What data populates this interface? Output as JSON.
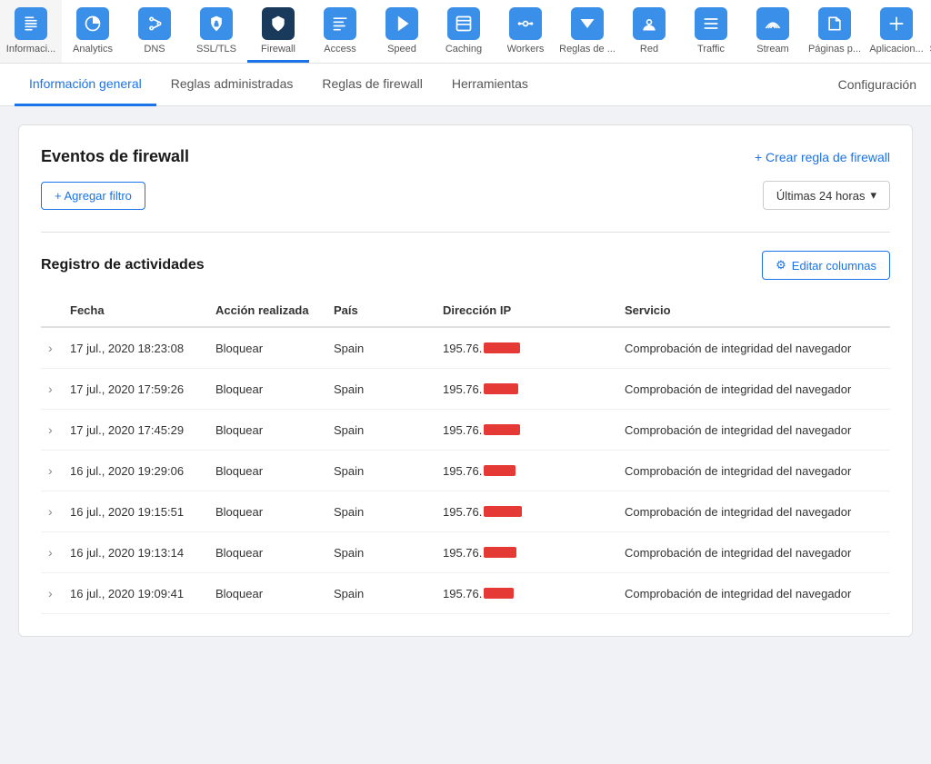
{
  "nav": {
    "items": [
      {
        "id": "informacion",
        "label": "Informaci...",
        "icon": "📄",
        "iconBg": "#3a8fe8",
        "active": false
      },
      {
        "id": "analytics",
        "label": "Analytics",
        "icon": "📊",
        "iconBg": "#3a8fe8",
        "active": false
      },
      {
        "id": "dns",
        "label": "DNS",
        "icon": "🔀",
        "iconBg": "#3a8fe8",
        "active": false
      },
      {
        "id": "ssl",
        "label": "SSL/TLS",
        "icon": "🔒",
        "iconBg": "#3a8fe8",
        "active": false
      },
      {
        "id": "firewall",
        "label": "Firewall",
        "icon": "🛡",
        "iconBg": "#1a3a5c",
        "active": true
      },
      {
        "id": "access",
        "label": "Access",
        "icon": "📋",
        "iconBg": "#3a8fe8",
        "active": false
      },
      {
        "id": "speed",
        "label": "Speed",
        "icon": "⚡",
        "iconBg": "#3a8fe8",
        "active": false
      },
      {
        "id": "caching",
        "label": "Caching",
        "icon": "⊡",
        "iconBg": "#3a8fe8",
        "active": false
      },
      {
        "id": "workers",
        "label": "Workers",
        "icon": "⟐",
        "iconBg": "#3a8fe8",
        "active": false
      },
      {
        "id": "reglas",
        "label": "Reglas de ...",
        "icon": "▽",
        "iconBg": "#3a8fe8",
        "active": false
      },
      {
        "id": "red",
        "label": "Red",
        "icon": "📍",
        "iconBg": "#3a8fe8",
        "active": false
      },
      {
        "id": "traffic",
        "label": "Traffic",
        "icon": "≡",
        "iconBg": "#3a8fe8",
        "active": false
      },
      {
        "id": "stream",
        "label": "Stream",
        "icon": "☁",
        "iconBg": "#3a8fe8",
        "active": false
      },
      {
        "id": "paginas",
        "label": "Páginas p...",
        "icon": "🔧",
        "iconBg": "#3a8fe8",
        "active": false
      },
      {
        "id": "aplicacion",
        "label": "Aplicacion...",
        "icon": "➕",
        "iconBg": "#3a8fe8",
        "active": false
      },
      {
        "id": "scrape",
        "label": "Scrape Shi...",
        "icon": "📝",
        "iconBg": "#3a8fe8",
        "active": false
      }
    ]
  },
  "tabs": {
    "items": [
      {
        "id": "general",
        "label": "Información general",
        "active": true
      },
      {
        "id": "administradas",
        "label": "Reglas administradas",
        "active": false
      },
      {
        "id": "firewall",
        "label": "Reglas de firewall",
        "active": false
      },
      {
        "id": "herramientas",
        "label": "Herramientas",
        "active": false
      }
    ],
    "config_label": "Configuración"
  },
  "events_section": {
    "title": "Eventos de firewall",
    "create_rule_label": "+ Crear regla de firewall",
    "add_filter_label": "+ Agregar filtro",
    "time_select_label": "Últimas 24 horas"
  },
  "activity_section": {
    "title": "Registro de actividades",
    "edit_columns_label": "Editar columnas",
    "columns": [
      "Fecha",
      "Acción realizada",
      "País",
      "Dirección IP",
      "Servicio"
    ],
    "rows": [
      {
        "fecha": "17 jul., 2020 18:23:08",
        "accion": "Bloquear",
        "pais": "Spain",
        "ip_prefix": "195.76.",
        "ip_redacted_width": 40,
        "servicio": "Comprobación de integridad del navegador"
      },
      {
        "fecha": "17 jul., 2020 17:59:26",
        "accion": "Bloquear",
        "pais": "Spain",
        "ip_prefix": "195.76.",
        "ip_redacted_width": 38,
        "servicio": "Comprobación de integridad del navegador"
      },
      {
        "fecha": "17 jul., 2020 17:45:29",
        "accion": "Bloquear",
        "pais": "Spain",
        "ip_prefix": "195.76.",
        "ip_redacted_width": 40,
        "servicio": "Comprobación de integridad del navegador"
      },
      {
        "fecha": "16 jul., 2020 19:29:06",
        "accion": "Bloquear",
        "pais": "Spain",
        "ip_prefix": "195.76.",
        "ip_redacted_width": 35,
        "servicio": "Comprobación de integridad del navegador"
      },
      {
        "fecha": "16 jul., 2020 19:15:51",
        "accion": "Bloquear",
        "pais": "Spain",
        "ip_prefix": "195.76.",
        "ip_redacted_width": 42,
        "servicio": "Comprobación de integridad del navegador"
      },
      {
        "fecha": "16 jul., 2020 19:13:14",
        "accion": "Bloquear",
        "pais": "Spain",
        "ip_prefix": "195.76.",
        "ip_redacted_width": 36,
        "servicio": "Comprobación de integridad del navegador"
      },
      {
        "fecha": "16 jul., 2020 19:09:41",
        "accion": "Bloquear",
        "pais": "Spain",
        "ip_prefix": "195.76.",
        "ip_redacted_width": 33,
        "servicio": "Comprobación de integridad del navegador"
      }
    ]
  },
  "icons": {
    "informacion": "📄",
    "analytics": "📊",
    "dns": "🔀",
    "ssl": "🔒",
    "firewall": "🛡",
    "access": "📋",
    "speed": "⚡",
    "caching": "☰",
    "workers": "◈",
    "reglas": "▽",
    "red": "📍",
    "traffic": "☰",
    "stream": "☁",
    "paginas": "🔧",
    "aplicacion": "➕",
    "scrape": "📝",
    "gear": "⚙",
    "chevron_down": "▾",
    "chevron_right": "›"
  }
}
